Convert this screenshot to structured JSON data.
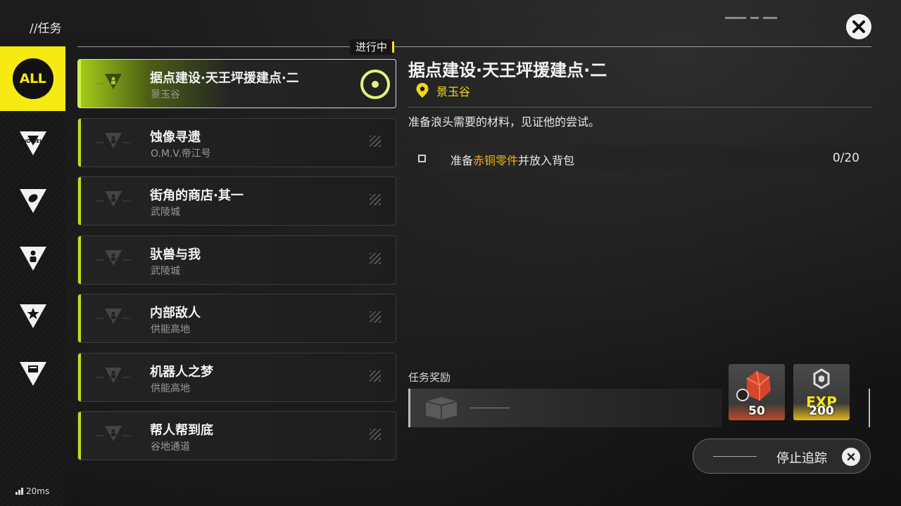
{
  "header": {
    "title": "//任务",
    "in_progress_label": "进行中"
  },
  "nav": {
    "items": [
      {
        "label": "ALL",
        "active": true
      },
      {
        "icon": "endfield-icon",
        "label": "ENDFIELD"
      },
      {
        "icon": "leaf-triangle-icon"
      },
      {
        "icon": "person-triangle-icon"
      },
      {
        "icon": "star-triangle-icon"
      },
      {
        "icon": "box-triangle-icon"
      }
    ]
  },
  "quests": [
    {
      "title": "据点建设·天王坪援建点·二",
      "location": "景玉谷",
      "selected": true,
      "tracked": true
    },
    {
      "title": "蚀像寻遗",
      "location": "O.M.V.帝江号"
    },
    {
      "title": "街角的商店·其一",
      "location": "武陵城"
    },
    {
      "title": "驮兽与我",
      "location": "武陵城"
    },
    {
      "title": "内部敌人",
      "location": "供能高地"
    },
    {
      "title": "机器人之梦",
      "location": "供能高地"
    },
    {
      "title": "帮人帮到底",
      "location": "谷地通道"
    }
  ],
  "detail": {
    "title": "据点建设·天王坪援建点·二",
    "location": "景玉谷",
    "description": "准备浪头需要的材料，见证他的尝试。",
    "objective": {
      "prefix": "准备",
      "highlight": "赤铜零件",
      "suffix": "并放入背包",
      "progress": "0/20"
    },
    "rewards_label": "任务奖励",
    "rewards": [
      {
        "name": "red-crystal-icon",
        "qty": "50"
      },
      {
        "name": "exp-icon",
        "label": "EXP",
        "qty": "200"
      }
    ],
    "stop_tracking_label": "停止追踪"
  },
  "status": {
    "ping": "20ms"
  },
  "colors": {
    "accent_yellow": "#f5ea12",
    "accent_green": "#b5e21a",
    "highlight_orange": "#f2b01a",
    "location_yellow": "#f2d61a"
  }
}
